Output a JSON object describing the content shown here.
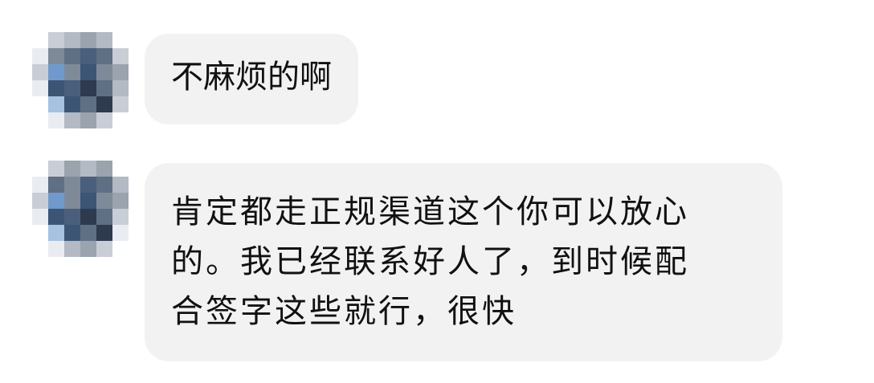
{
  "chat": {
    "messages": [
      {
        "sender": "contact",
        "lines": [
          "不麻烦的啊"
        ]
      },
      {
        "sender": "contact",
        "lines": [
          "肯定都走正规渠道这个你可以放心",
          "的。我已经联系好人了，到时候配",
          "合签字这些就行，很快"
        ]
      }
    ]
  },
  "avatar": {
    "style": "pixelated-mosaic",
    "palette": [
      "#ffffff",
      "#e9ecf0",
      "#c9ced6",
      "#b3bac4",
      "#9aa3ae",
      "#7f8a98",
      "#5f6f84",
      "#4a5f7c",
      "#3c5575",
      "#2e3a4e",
      "#6f9acb",
      "#a7c1e0"
    ]
  }
}
